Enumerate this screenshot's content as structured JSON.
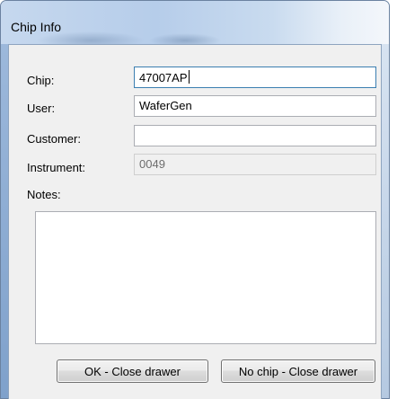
{
  "window": {
    "title": "Chip Info"
  },
  "form": {
    "chip": {
      "label": "Chip:",
      "value": "47007AP"
    },
    "user": {
      "label": "User:",
      "value": "WaferGen"
    },
    "customer": {
      "label": "Customer:",
      "value": ""
    },
    "instrument": {
      "label": "Instrument:",
      "value": "0049"
    },
    "notes": {
      "label": "Notes:",
      "value": ""
    }
  },
  "buttons": {
    "ok_label": "OK - Close drawer",
    "no_chip_label": "No chip - Close drawer"
  }
}
